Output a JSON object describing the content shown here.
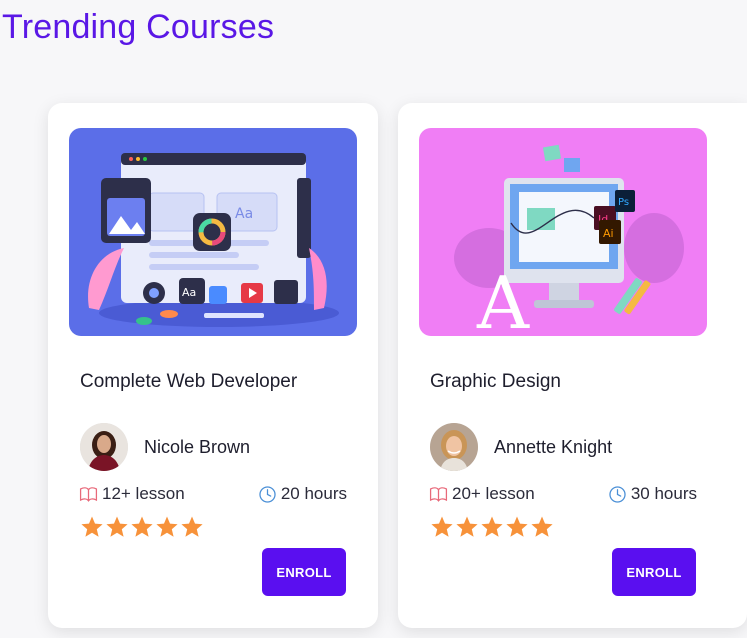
{
  "page": {
    "title": "Trending Courses"
  },
  "colors": {
    "accent": "#5a0ff0",
    "title": "#5a17e6",
    "star": "#f7923a",
    "meta_icon_lesson": "#e8697a",
    "meta_icon_clock": "#4a8fd6"
  },
  "courses": [
    {
      "title": "Complete Web Developer",
      "instructor": "Nicole Brown",
      "lessons": "12+ lesson",
      "hours": "20 hours",
      "rating": 5,
      "enroll_label": "ENROLL",
      "thumbnail_color": "#5b6ee8"
    },
    {
      "title": "Graphic Design",
      "instructor": "Annette Knight",
      "lessons": "20+ lesson",
      "hours": "30 hours",
      "rating": 5,
      "enroll_label": "ENROLL",
      "thumbnail_color": "#f07ef5"
    }
  ],
  "icons": {
    "lesson": "book-icon",
    "hours": "clock-icon",
    "rating": "star-icon"
  }
}
